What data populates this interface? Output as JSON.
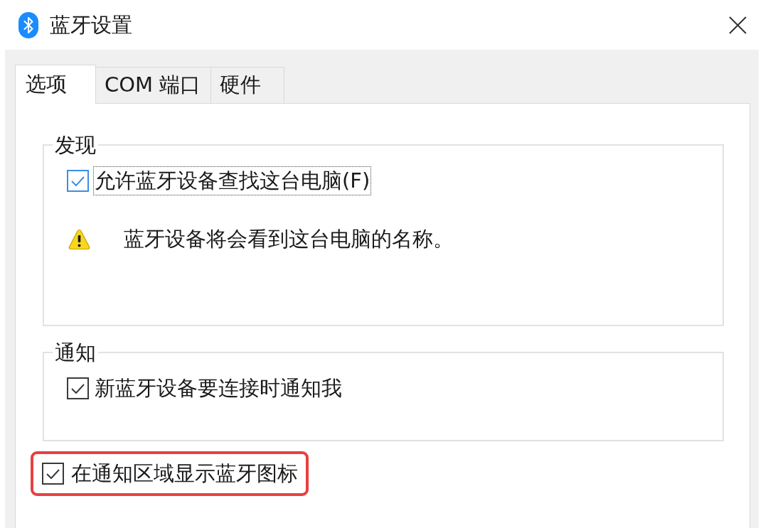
{
  "window": {
    "title": "蓝牙设置"
  },
  "tabs": [
    {
      "label": "选项",
      "selected": true
    },
    {
      "label": "COM 端口",
      "selected": false
    },
    {
      "label": "硬件",
      "selected": false
    }
  ],
  "groups": [
    {
      "title": "发现",
      "items": [
        {
          "kind": "checkbox",
          "label": "允许蓝牙设备查找这台电脑(F)",
          "checked": true,
          "focused": true
        },
        {
          "kind": "warning",
          "text": "蓝牙设备将会看到这台电脑的名称。"
        }
      ]
    },
    {
      "title": "通知",
      "items": [
        {
          "kind": "checkbox",
          "label": "新蓝牙设备要连接时通知我",
          "checked": true,
          "focused": false
        }
      ]
    }
  ],
  "options": [
    {
      "kind": "checkbox",
      "label": "在通知区域显示蓝牙图标",
      "checked": true,
      "focused": false,
      "highlighted": true
    }
  ]
}
